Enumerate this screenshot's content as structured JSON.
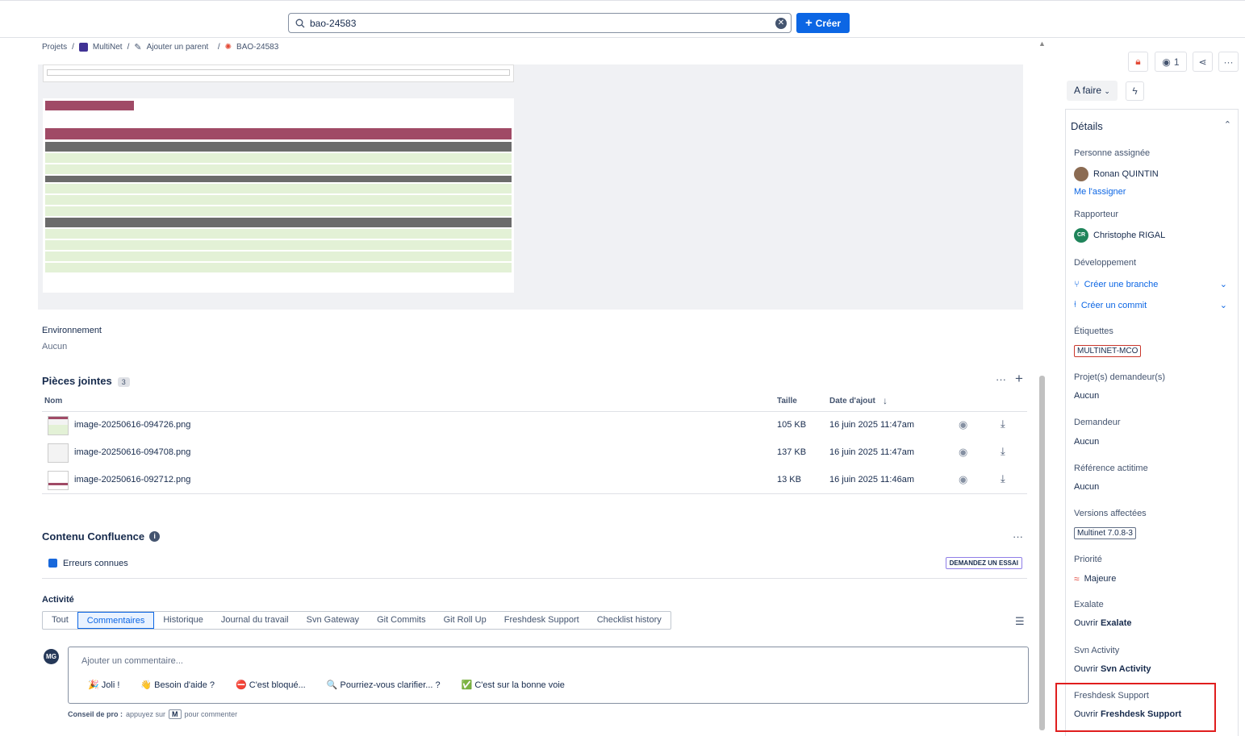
{
  "search": {
    "value": "bao-24583"
  },
  "header": {
    "create_label": "Créer"
  },
  "breadcrumbs": {
    "projects": "Projets",
    "project": "MultiNet",
    "add_parent": "Ajouter un parent",
    "issue_key": "BAO-24583"
  },
  "environment": {
    "label": "Environnement",
    "value": "Aucun"
  },
  "attachments": {
    "title": "Pièces jointes",
    "count": "3",
    "columns": {
      "name": "Nom",
      "size": "Taille",
      "date": "Date d'ajout"
    },
    "rows": [
      {
        "name": "image-20250616-094726.png",
        "size": "105 KB",
        "date": "16 juin 2025 11:47am"
      },
      {
        "name": "image-20250616-094708.png",
        "size": "137 KB",
        "date": "16 juin 2025 11:47am"
      },
      {
        "name": "image-20250616-092712.png",
        "size": "13 KB",
        "date": "16 juin 2025 11:46am"
      }
    ]
  },
  "confluence": {
    "title": "Contenu Confluence",
    "page": "Erreurs connues",
    "trial": "DEMANDEZ UN ESSAI"
  },
  "activity": {
    "title": "Activité",
    "tabs": [
      "Tout",
      "Commentaires",
      "Historique",
      "Journal du travail",
      "Svn Gateway",
      "Git Commits",
      "Git Roll Up",
      "Freshdesk Support",
      "Checklist history"
    ],
    "avatar": "MG",
    "comment_placeholder": "Ajouter un commentaire...",
    "chips": [
      "🎉 Joli !",
      "👋 Besoin d'aide ?",
      "⛔ C'est bloqué...",
      "🔍 Pourriez-vous clarifier... ?",
      "✅ C'est sur la bonne voie"
    ],
    "tip_bold": "Conseil de pro :",
    "tip_pre": "appuyez sur",
    "tip_key": "M",
    "tip_post": "pour commenter"
  },
  "right": {
    "watchers": "1",
    "status": "A faire",
    "details_title": "Détails",
    "assignee_label": "Personne assignée",
    "assignee": "Ronan QUINTIN",
    "assign_me": "Me l'assigner",
    "reporter_label": "Rapporteur",
    "reporter_initials": "CR",
    "reporter": "Christophe RIGAL",
    "dev_label": "Développement",
    "create_branch": "Créer une branche",
    "create_commit": "Créer un commit",
    "labels_label": "Étiquettes",
    "label_tag": "MULTINET-MCO",
    "req_projects_label": "Projet(s) demandeur(s)",
    "req_projects": "Aucun",
    "requester_label": "Demandeur",
    "requester": "Aucun",
    "actitime_label": "Référence actitime",
    "actitime": "Aucun",
    "versions_label": "Versions affectées",
    "version": "Multinet 7.0.8-3",
    "priority_label": "Priorité",
    "priority": "Majeure",
    "exalate_label": "Exalate",
    "exalate_open": "Ouvrir",
    "exalate_name": "Exalate",
    "svn_label": "Svn Activity",
    "svn_open": "Ouvrir",
    "svn_name": "Svn Activity",
    "fd_label": "Freshdesk Support",
    "fd_open": "Ouvrir",
    "fd_name": "Freshdesk Support"
  },
  "colors": {
    "accent": "#0c66e4",
    "highlight_box": "#e01e1e"
  }
}
